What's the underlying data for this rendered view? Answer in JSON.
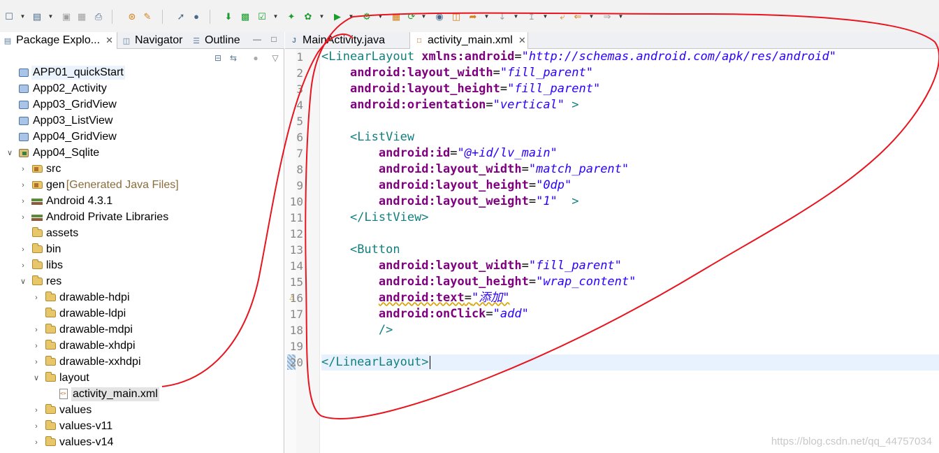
{
  "toolbar": {
    "items": [
      "new-icon",
      "new-package-icon",
      "save-icon",
      "save-all-icon",
      "print-icon",
      "open-type-icon",
      "open-task-icon",
      "pin-icon",
      "pin-editor-icon",
      "sdk-manager-icon",
      "avd-manager-icon",
      "lint-icon",
      "new-android-project-icon",
      "debug-icon",
      "run-icon",
      "external-tools-icon",
      "new-class-icon",
      "coverage-icon",
      "search-icon",
      "open-folder-icon",
      "back-icon",
      "forward-icon",
      "next-annotation-icon",
      "previous-annotation-icon",
      "last-edit-icon"
    ]
  },
  "left_panel": {
    "tabs": [
      {
        "label": "Package Explo...",
        "active": true
      },
      {
        "label": "Navigator",
        "active": false
      },
      {
        "label": "Outline",
        "active": false
      }
    ],
    "tree": [
      {
        "label": "APP01_quickStart",
        "depth": 0,
        "arrow": "none",
        "icon": "project-closed-icon",
        "state": "hover"
      },
      {
        "label": "App02_Activity",
        "depth": 0,
        "arrow": "none",
        "icon": "project-closed-icon"
      },
      {
        "label": "App03_GridView",
        "depth": 0,
        "arrow": "none",
        "icon": "project-closed-icon"
      },
      {
        "label": "App03_ListView",
        "depth": 0,
        "arrow": "none",
        "icon": "project-closed-icon"
      },
      {
        "label": "App04_GridView",
        "depth": 0,
        "arrow": "none",
        "icon": "project-closed-icon"
      },
      {
        "label": "App04_Sqlite",
        "depth": 0,
        "arrow": "expanded",
        "icon": "project-open-icon"
      },
      {
        "label": "src",
        "depth": 1,
        "arrow": "collapsed",
        "icon": "source-folder-icon"
      },
      {
        "label": "gen",
        "suffix": "[Generated Java Files]",
        "depth": 1,
        "arrow": "collapsed",
        "icon": "source-folder-icon"
      },
      {
        "label": "Android 4.3.1",
        "depth": 1,
        "arrow": "collapsed",
        "icon": "library-icon"
      },
      {
        "label": "Android Private Libraries",
        "depth": 1,
        "arrow": "collapsed",
        "icon": "library-icon"
      },
      {
        "label": "assets",
        "depth": 1,
        "arrow": "none",
        "icon": "folder-icon"
      },
      {
        "label": "bin",
        "depth": 1,
        "arrow": "collapsed",
        "icon": "folder-icon"
      },
      {
        "label": "libs",
        "depth": 1,
        "arrow": "collapsed",
        "icon": "folder-icon"
      },
      {
        "label": "res",
        "depth": 1,
        "arrow": "expanded",
        "icon": "folder-icon"
      },
      {
        "label": "drawable-hdpi",
        "depth": 2,
        "arrow": "collapsed",
        "icon": "folder-icon"
      },
      {
        "label": "drawable-ldpi",
        "depth": 2,
        "arrow": "none",
        "icon": "folder-icon"
      },
      {
        "label": "drawable-mdpi",
        "depth": 2,
        "arrow": "collapsed",
        "icon": "folder-icon"
      },
      {
        "label": "drawable-xhdpi",
        "depth": 2,
        "arrow": "collapsed",
        "icon": "folder-icon"
      },
      {
        "label": "drawable-xxhdpi",
        "depth": 2,
        "arrow": "collapsed",
        "icon": "folder-icon"
      },
      {
        "label": "layout",
        "depth": 2,
        "arrow": "expanded",
        "icon": "folder-icon"
      },
      {
        "label": "activity_main.xml",
        "depth": 3,
        "arrow": "none",
        "icon": "xml-file-icon",
        "state": "selected"
      },
      {
        "label": "values",
        "depth": 2,
        "arrow": "collapsed",
        "icon": "folder-icon"
      },
      {
        "label": "values-v11",
        "depth": 2,
        "arrow": "collapsed",
        "icon": "folder-icon"
      },
      {
        "label": "values-v14",
        "depth": 2,
        "arrow": "collapsed",
        "icon": "folder-icon"
      }
    ]
  },
  "editor": {
    "tabs": [
      {
        "label": "MainActivity.java",
        "active": false,
        "icon": "java-file-icon"
      },
      {
        "label": "activity_main.xml",
        "active": true,
        "icon": "xml-file-icon"
      }
    ],
    "lines": [
      {
        "n": "1",
        "tokens": [
          [
            "tag",
            "<LinearLayout "
          ],
          [
            "attr",
            "xmlns:android"
          ],
          [
            "eq",
            "="
          ],
          [
            "val",
            "\"http://schemas.android.com/apk/res/android\""
          ]
        ]
      },
      {
        "n": "2",
        "tokens": [
          [
            "sp",
            "    "
          ],
          [
            "attr",
            "android:layout_width"
          ],
          [
            "eq",
            "="
          ],
          [
            "val",
            "\"fill_parent\""
          ]
        ]
      },
      {
        "n": "3",
        "tokens": [
          [
            "sp",
            "    "
          ],
          [
            "attr",
            "android:layout_height"
          ],
          [
            "eq",
            "="
          ],
          [
            "val",
            "\"fill_parent\""
          ]
        ]
      },
      {
        "n": "4",
        "tokens": [
          [
            "sp",
            "    "
          ],
          [
            "attr",
            "android:orientation"
          ],
          [
            "eq",
            "="
          ],
          [
            "val",
            "\"vertical\""
          ],
          [
            "tag",
            " >"
          ]
        ]
      },
      {
        "n": "5",
        "tokens": []
      },
      {
        "n": "6",
        "tokens": [
          [
            "sp",
            "    "
          ],
          [
            "tag",
            "<ListView"
          ]
        ]
      },
      {
        "n": "7",
        "tokens": [
          [
            "sp",
            "        "
          ],
          [
            "attr",
            "android:id"
          ],
          [
            "eq",
            "="
          ],
          [
            "val",
            "\"@+id/lv_main\""
          ]
        ]
      },
      {
        "n": "8",
        "tokens": [
          [
            "sp",
            "        "
          ],
          [
            "attr",
            "android:layout_width"
          ],
          [
            "eq",
            "="
          ],
          [
            "val",
            "\"match_parent\""
          ]
        ]
      },
      {
        "n": "9",
        "tokens": [
          [
            "sp",
            "        "
          ],
          [
            "attr",
            "android:layout_height"
          ],
          [
            "eq",
            "="
          ],
          [
            "val",
            "\"0dp\""
          ]
        ]
      },
      {
        "n": "10",
        "tokens": [
          [
            "sp",
            "        "
          ],
          [
            "attr",
            "android:layout_weight"
          ],
          [
            "eq",
            "="
          ],
          [
            "val",
            "\"1\""
          ],
          [
            "tag",
            "  >"
          ]
        ]
      },
      {
        "n": "11",
        "tokens": [
          [
            "sp",
            "    "
          ],
          [
            "tag",
            "</ListView>"
          ]
        ]
      },
      {
        "n": "12",
        "tokens": []
      },
      {
        "n": "13",
        "tokens": [
          [
            "sp",
            "    "
          ],
          [
            "tag",
            "<Button"
          ]
        ]
      },
      {
        "n": "14",
        "tokens": [
          [
            "sp",
            "        "
          ],
          [
            "attr",
            "android:layout_width"
          ],
          [
            "eq",
            "="
          ],
          [
            "val",
            "\"fill_parent\""
          ]
        ]
      },
      {
        "n": "15",
        "tokens": [
          [
            "sp",
            "        "
          ],
          [
            "attr",
            "android:layout_height"
          ],
          [
            "eq",
            "="
          ],
          [
            "val",
            "\"wrap_content\""
          ]
        ]
      },
      {
        "n": "16",
        "warning": true,
        "tokens": [
          [
            "sp",
            "        "
          ],
          [
            "attr squig",
            "android:text"
          ],
          [
            "eq squig",
            "="
          ],
          [
            "val squig",
            "\"添加\""
          ]
        ]
      },
      {
        "n": "17",
        "tokens": [
          [
            "sp",
            "        "
          ],
          [
            "attr",
            "android:onClick"
          ],
          [
            "eq",
            "="
          ],
          [
            "val",
            "\"add\""
          ]
        ]
      },
      {
        "n": "18",
        "tokens": [
          [
            "sp",
            "        "
          ],
          [
            "tag",
            "/>"
          ]
        ]
      },
      {
        "n": "19",
        "tokens": []
      },
      {
        "n": "20",
        "current": true,
        "caret": true,
        "tokens": [
          [
            "tag",
            "</LinearLayout>"
          ]
        ]
      }
    ]
  },
  "watermark": "https://blog.csdn.net/qq_44757034",
  "colors": {
    "tag": "#117f7f",
    "attribute": "#7f007f",
    "value": "#2a00ff",
    "annotation": "#e8141e",
    "current_line": "#e8f2fe"
  }
}
